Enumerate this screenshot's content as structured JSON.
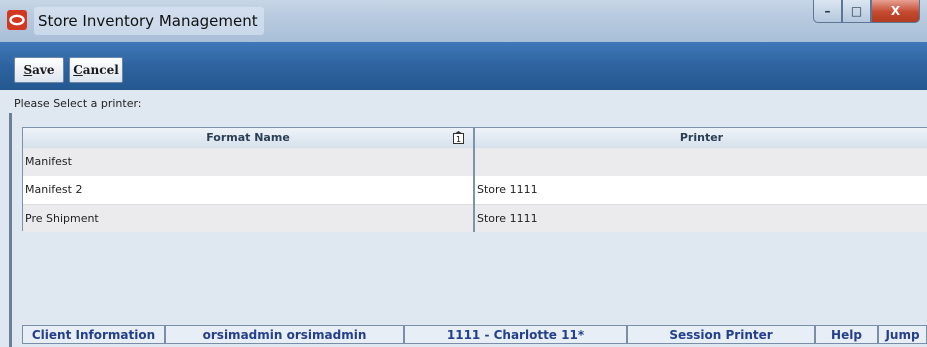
{
  "window": {
    "title": "Store Inventory Management",
    "controls": {
      "minimize": "–",
      "maximize": "□",
      "close": "X"
    }
  },
  "toolbar": {
    "save_key": "S",
    "save_rest": "ave",
    "cancel_key": "C",
    "cancel_rest": "ancel"
  },
  "prompt": "Please Select a printer:",
  "table": {
    "headers": {
      "format_name": "Format Name",
      "printer": "Printer"
    },
    "sort_indicator": "1",
    "rows": [
      {
        "format_name": "Manifest",
        "printer": ""
      },
      {
        "format_name": "Manifest 2",
        "printer": "Store 1111"
      },
      {
        "format_name": "Pre Shipment",
        "printer": "Store 1111"
      }
    ]
  },
  "status": {
    "client_information": "Client Information",
    "user": "orsimadmin orsimadmin",
    "store": "1111 - Charlotte 11*",
    "session_printer": "Session Printer",
    "help": "Help",
    "jump": "Jump"
  },
  "colors": {
    "toolbar": "#2d639f",
    "status_text": "#24408c",
    "close_button": "#c34a2f",
    "app_icon": "#d2371f"
  },
  "icons": [
    "oracle-app-icon",
    "sort-ascending-icon"
  ]
}
